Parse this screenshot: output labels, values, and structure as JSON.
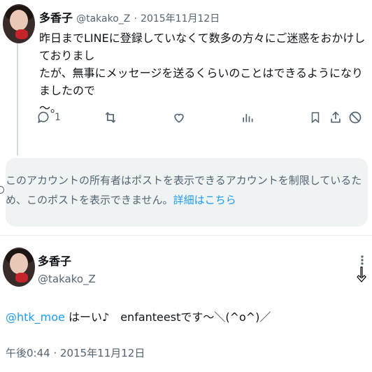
{
  "tweet1": {
    "name": "多香子",
    "handle": "@takako_Z",
    "dot": "·",
    "date": "2015年11月12日",
    "text_line1": "昨日までLINEに登録していなくて数多の方々にご迷惑をおかけしておりまし",
    "text_line2": "たが、無事にメッセージを送るくらいのことはできるようになりましたので",
    "text_line3": "〜。",
    "reply_count": "1",
    "icons": [
      "reply-icon",
      "retweet-icon",
      "like-icon",
      "views-icon",
      "bookmark-icon",
      "share-icon",
      "block-icon"
    ]
  },
  "notice": {
    "line1": "このアカウントの所有者はポストを表示できるアカウントを制限しているた",
    "line2_prefix": "め、このポストを表示できません。",
    "link": "詳細はこちら"
  },
  "tweet2": {
    "name": "多香子",
    "handle": "@takako_Z",
    "mention": "@htk_moe",
    "text": " はーい♪　enfanteestです〜＼(^o^)／",
    "timestamp": "午後0:44 · 2015年11月12日"
  },
  "colors": {
    "link": "#1d9bf0",
    "muted": "#536471",
    "notice_bg": "#eff3f4"
  }
}
